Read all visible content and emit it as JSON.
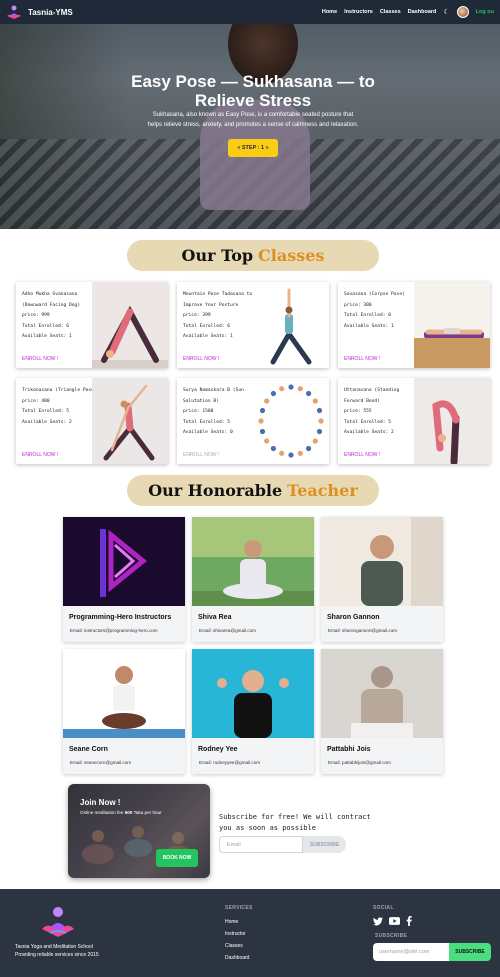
{
  "navbar": {
    "brand": "Tasnia-YMS",
    "links": [
      "Home",
      "Instructors",
      "Classes",
      "Dashboard"
    ],
    "logout": "Log ou"
  },
  "hero": {
    "title": "Easy Pose — Sukhasana — to Relieve Stress",
    "description": "Sukhasana, also known as Easy Pose, is a comfortable seated posture that helps relieve stress, anxiety, and promotes a sense of calmness and relaxation.",
    "step_label": "« STEP : 1 »"
  },
  "classes_section": {
    "title": "Our Top",
    "accent": "Classes"
  },
  "classes": [
    {
      "name": "Adho Mukha Svanasana (Downward Facing Dog)",
      "price": "price: 999",
      "enrolled": "Total Enrolled: 6",
      "seats": "Available Seats: 1",
      "enroll": "ENROLL NOW !",
      "disabled": false,
      "pose": "downward-dog"
    },
    {
      "name": "Mountain Pose Tadasana to Improve Your Posture",
      "price": "price: 399",
      "enrolled": "Total Enrolled: 6",
      "seats": "Available Seats: 1",
      "enroll": "ENROLL NOW !",
      "disabled": false,
      "pose": "warrior"
    },
    {
      "name": "Savasana (Corpse Pose)",
      "price": "price: 300",
      "enrolled": "Total Enrolled: 0",
      "seats": "Available Seats: 1",
      "enroll": "ENROLL NOW !",
      "disabled": false,
      "pose": "corpse"
    },
    {
      "name": "Trikonasana (Triangle Pose)",
      "price": "price: 400",
      "enrolled": "Total Enrolled: 5",
      "seats": "Available Seats: 2",
      "enroll": "ENROLL NOW !",
      "disabled": false,
      "pose": "triangle"
    },
    {
      "name": "Surya Namaskara B (Sun Salutation B)",
      "price": "price: 1500",
      "enrolled": "Total Enrolled: 5",
      "seats": "Available Seats: 0",
      "enroll": "ENROLL NOW !",
      "disabled": true,
      "pose": "sun-salutation"
    },
    {
      "name": "Uttanasana (Standing Forward Bend)",
      "price": "price: 555",
      "enrolled": "Total Enrolled: 5",
      "seats": "Available Seats: 2",
      "enroll": "ENROLL NOW !",
      "disabled": false,
      "pose": "forward-bend"
    }
  ],
  "teachers_section": {
    "title": "Our Honorable",
    "accent": "Teacher"
  },
  "teachers": [
    {
      "name": "Programming-Hero Instructors",
      "email": "Email: instructors@programming-hero.com"
    },
    {
      "name": "Shiva Rea",
      "email": "Email: shivarea@gmail.com"
    },
    {
      "name": "Sharon Gannon",
      "email": "Email: sharongannon@gmail.com"
    },
    {
      "name": "Seane Corn",
      "email": "Email: seanecorn@gmail.com"
    },
    {
      "name": "Rodney Yee",
      "email": "Email: rodneyyee@gmail.com"
    },
    {
      "name": "Pattabhi Jois",
      "email": "Email: pattabhijois@gmail.com"
    }
  ],
  "join": {
    "title": "Join Now !",
    "desc_prefix": "Online meditation fee",
    "fee": "500",
    "desc_suffix": "Taka per hour",
    "button": "BOOK NOW"
  },
  "subscribe": {
    "text": "Subscribe for free! We will contract you as soon as possible",
    "placeholder": "Email",
    "button": "SUBSCRIBE"
  },
  "footer": {
    "org": "Tasnia Yoga and Meditation School",
    "tagline": "Providing reliable services since 2015",
    "services_heading": "SERVICES",
    "services": [
      "Home",
      "Instructor",
      "Classes",
      "Dashboard"
    ],
    "social_heading": "SOCIAL",
    "subscribe_heading": "SUBSCRIBE",
    "placeholder": "username@site.com",
    "button": "SUBSCRIBE"
  },
  "colors": {
    "accent": "#e08e1f",
    "banner": "#e6d9b4",
    "enroll": "#c026d3",
    "green": "#22c55e",
    "footer": "#2d3441",
    "yellow": "#facc15"
  }
}
